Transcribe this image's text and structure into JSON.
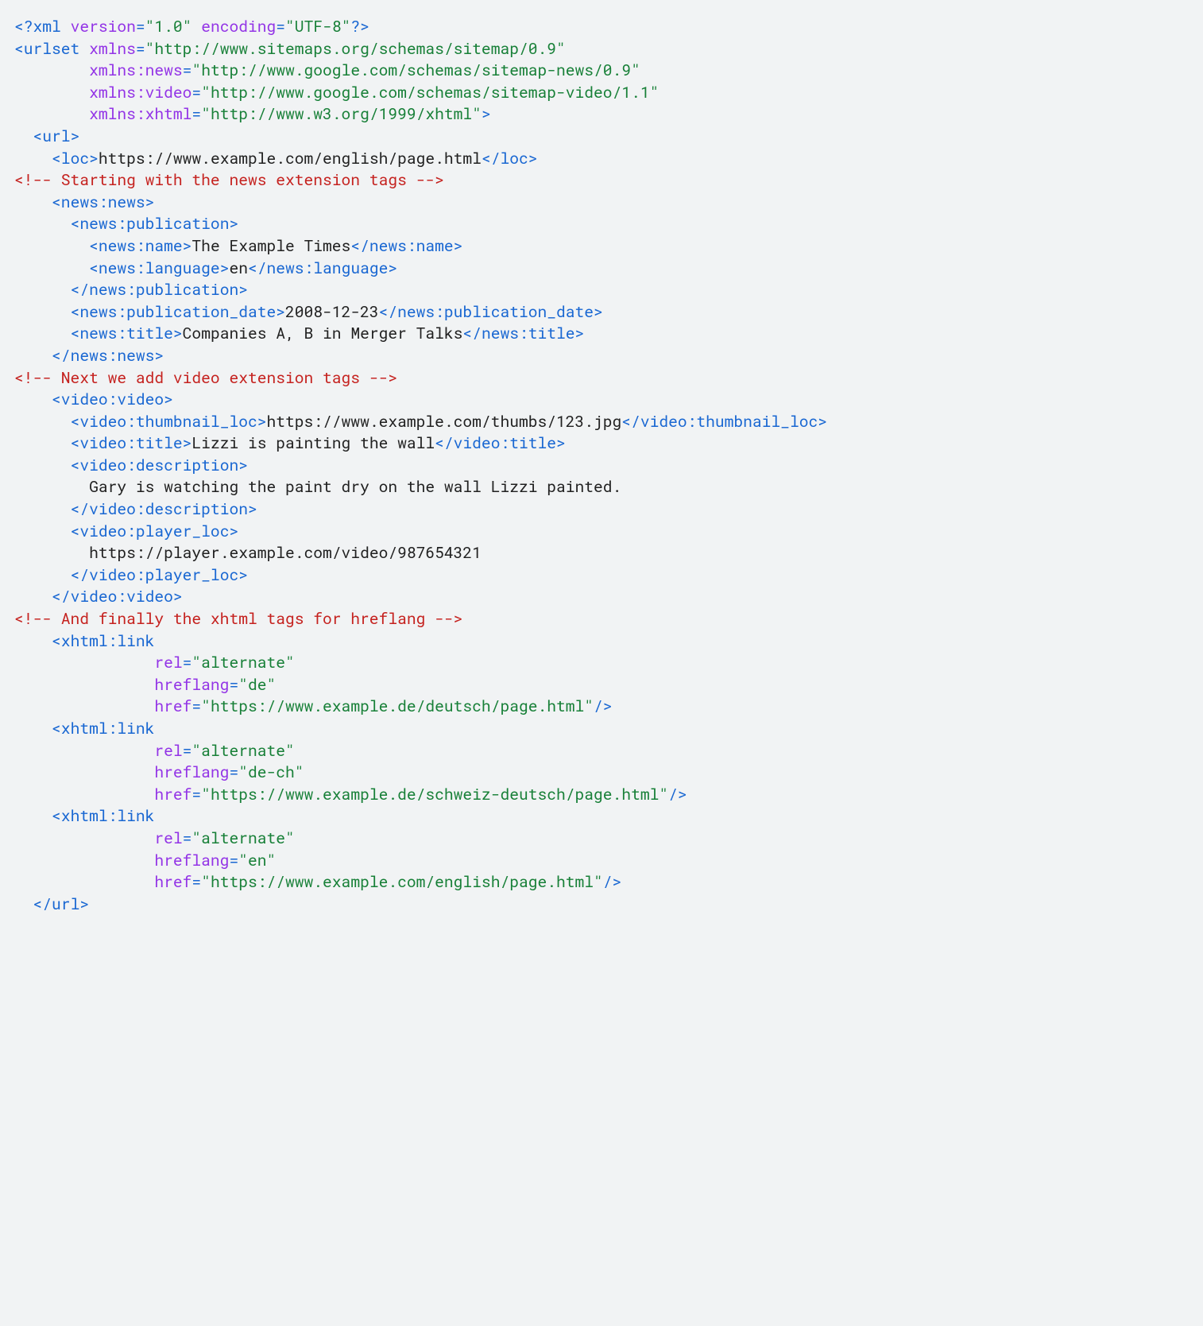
{
  "colors": {
    "tag": "#1967d2",
    "attr": "#9334e6",
    "string": "#188038",
    "comment": "#c5221f",
    "text": "#212121",
    "bg": "#f1f3f4"
  },
  "xml_decl": {
    "version": "1.0",
    "encoding": "UTF-8"
  },
  "urlset_attrs": [
    {
      "name": "xmlns",
      "value": "http://www.sitemaps.org/schemas/sitemap/0.9"
    },
    {
      "name": "xmlns:news",
      "value": "http://www.google.com/schemas/sitemap-news/0.9"
    },
    {
      "name": "xmlns:video",
      "value": "http://www.google.com/schemas/sitemap-video/1.1"
    },
    {
      "name": "xmlns:xhtml",
      "value": "http://www.w3.org/1999/xhtml"
    }
  ],
  "url": {
    "loc": "https://www.example.com/english/page.html",
    "comments": {
      "news": "Starting with the news extension tags",
      "video": "Next we add video extension tags",
      "xhtml": "And finally the xhtml tags for hreflang"
    },
    "news": {
      "publication": {
        "name": "The Example Times",
        "language": "en"
      },
      "publication_date": "2008-12-23",
      "title": "Companies A, B in Merger Talks"
    },
    "video": {
      "thumbnail_loc": "https://www.example.com/thumbs/123.jpg",
      "title": "Lizzi is painting the wall",
      "description": "Gary is watching the paint dry on the wall Lizzi painted.",
      "player_loc": "https://player.example.com/video/987654321"
    },
    "xhtml_links": [
      {
        "rel": "alternate",
        "hreflang": "de",
        "href": "https://www.example.de/deutsch/page.html"
      },
      {
        "rel": "alternate",
        "hreflang": "de-ch",
        "href": "https://www.example.de/schweiz-deutsch/page.html"
      },
      {
        "rel": "alternate",
        "hreflang": "en",
        "href": "https://www.example.com/english/page.html"
      }
    ]
  }
}
